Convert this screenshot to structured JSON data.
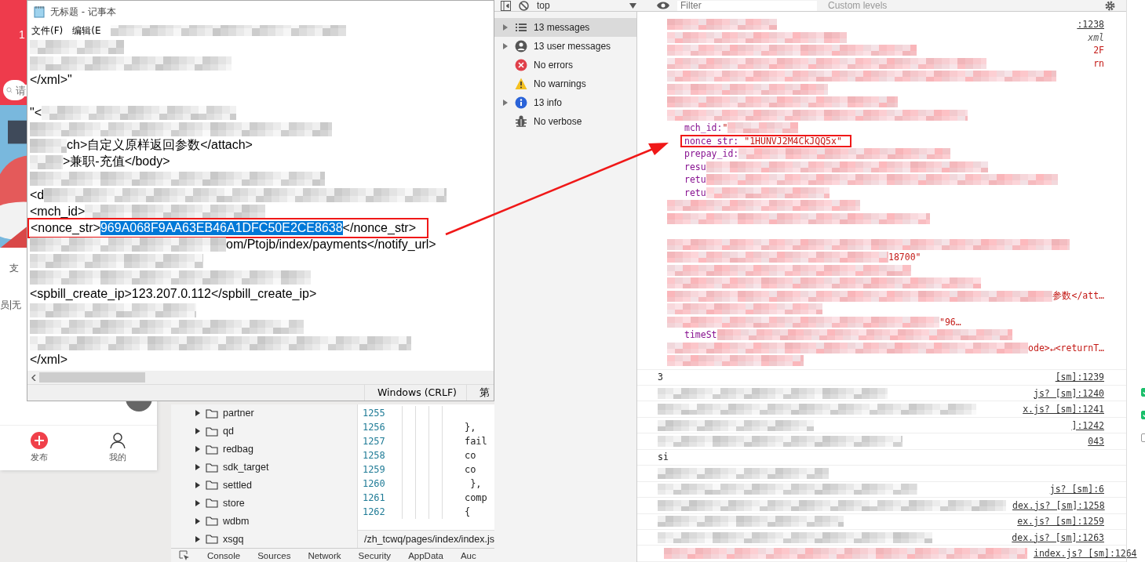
{
  "phone": {
    "status_text": "1",
    "search_placeholder": "请",
    "feed_texts": [
      "支",
      "员|无"
    ],
    "tabbar": [
      {
        "label": "发布",
        "kind": "publish"
      },
      {
        "label": "我的",
        "kind": "profile"
      }
    ]
  },
  "notepad": {
    "title": "无标题 - 记事本",
    "menu": [
      "文件(F)",
      "编辑(E"
    ],
    "lines": [
      {
        "kind": "redacted"
      },
      {
        "kind": "redacted"
      },
      {
        "kind": "text",
        "text": "</xml>\""
      },
      {
        "kind": "blank"
      },
      {
        "kind": "head",
        "text": "\"<"
      },
      {
        "kind": "redacted"
      },
      {
        "kind": "tail",
        "text": "ch>自定义原样返回参数</attach>"
      },
      {
        "kind": "tail",
        "text": ">兼职-充值</body>"
      },
      {
        "kind": "redacted"
      },
      {
        "kind": "head",
        "text": "<d"
      },
      {
        "kind": "head",
        "text": "<mch_id>"
      },
      {
        "kind": "selection",
        "before": "<nonce_str>",
        "selected_text": "969A068F9AA63EB46A1DFC50E2CE8638",
        "after": "</nonce_str>"
      },
      {
        "kind": "tail",
        "text": "om/Ptojb/index/payments</notify_url>"
      },
      {
        "kind": "redacted"
      },
      {
        "kind": "redacted"
      },
      {
        "kind": "text",
        "text": "<spbill_create_ip>123.207.0.112</spbill_create_ip>"
      },
      {
        "kind": "redacted"
      },
      {
        "kind": "redacted"
      },
      {
        "kind": "redacted"
      },
      {
        "kind": "text",
        "text": "</xml>"
      }
    ],
    "status": [
      "Windows (CRLF)",
      "第"
    ]
  },
  "sources": {
    "folders": [
      "partner",
      "qd",
      "redbag",
      "sdk_target",
      "settled",
      "store",
      "wdbm",
      "xsgq"
    ],
    "code_lines": [
      {
        "num": "1255"
      },
      {
        "num": "1256",
        "code": "},"
      },
      {
        "num": "1257",
        "code": "fail"
      },
      {
        "num": "1258",
        "code": "co"
      },
      {
        "num": "1259",
        "code": "co"
      },
      {
        "num": "1260",
        "code": " },"
      },
      {
        "num": "1261",
        "code": "comp"
      },
      {
        "num": "1262",
        "code": "{"
      }
    ],
    "file_path": "/zh_tcwq/pages/index/index.js"
  },
  "drawer_tabs": [
    "Console",
    "Sources",
    "Network",
    "Security",
    "AppData",
    "Auc"
  ],
  "console": {
    "context": "top",
    "filter_placeholder": "Filter",
    "levels": "Custom levels",
    "sidebar": [
      {
        "kind": "messages",
        "label": "13 messages",
        "expandable": true,
        "selected": true
      },
      {
        "kind": "user",
        "label": "13 user messages",
        "expandable": true,
        "selected": false
      },
      {
        "kind": "errors",
        "label": "No errors",
        "expandable": false,
        "selected": false
      },
      {
        "kind": "warnings",
        "label": "No warnings",
        "expandable": false,
        "selected": false
      },
      {
        "kind": "info",
        "label": "13 info",
        "expandable": true,
        "selected": false
      },
      {
        "kind": "verbose",
        "label": "No verbose",
        "expandable": false,
        "selected": false
      }
    ],
    "object_lines": [
      {
        "kind": "redacted",
        "right": {
          "kind": "link",
          "text": ":1238"
        }
      },
      {
        "kind": "redacted",
        "right": {
          "kind": "muted",
          "text": "xml"
        }
      },
      {
        "kind": "redacted",
        "right": {
          "kind": "string",
          "text": "2F"
        }
      },
      {
        "kind": "redacted",
        "right": {
          "kind": "string",
          "text": "rn"
        }
      },
      {
        "kind": "redacted"
      },
      {
        "kind": "redacted"
      },
      {
        "kind": "redacted"
      },
      {
        "kind": "redacted"
      },
      {
        "kind": "pair",
        "key": "mch_id:",
        "value": "\""
      },
      {
        "kind": "framed_pair",
        "key": "nonce_str:",
        "value": "\"1HUNVJ2M4CkJQQ5x\""
      },
      {
        "kind": "key",
        "key": "prepay_id:"
      },
      {
        "kind": "key",
        "key": "resu"
      },
      {
        "kind": "key",
        "key": "retu"
      },
      {
        "kind": "key",
        "key": "retu"
      },
      {
        "kind": "redacted"
      },
      {
        "kind": "redacted"
      },
      {
        "kind": "blank"
      },
      {
        "kind": "redacted"
      },
      {
        "kind": "tail",
        "value": "18700\""
      },
      {
        "kind": "redacted"
      },
      {
        "kind": "redacted"
      },
      {
        "kind": "tail",
        "value": "参数</att…"
      },
      {
        "kind": "redacted"
      },
      {
        "kind": "tail",
        "value": "\"96…"
      },
      {
        "kind": "key",
        "key": "timeSt"
      },
      {
        "kind": "tail",
        "value": "ode>↵<return",
        "right": {
          "kind": "string",
          "text": "T…"
        }
      },
      {
        "kind": "redacted"
      }
    ],
    "log_rows": [
      {
        "kind": "plain",
        "text": "3",
        "source": "[sm]:1239"
      },
      {
        "kind": "redacted",
        "source": "js? [sm]:1240"
      },
      {
        "kind": "redacted",
        "source": "x.js? [sm]:1241"
      },
      {
        "kind": "redacted",
        "source": "]:1242"
      },
      {
        "kind": "redacted",
        "source": "043"
      },
      {
        "kind": "plain",
        "text": "si"
      },
      {
        "kind": "redacted"
      },
      {
        "kind": "redacted",
        "source": "js? [sm]:6"
      },
      {
        "kind": "redacted",
        "source": "dex.js? [sm]:1258"
      },
      {
        "kind": "redacted",
        "source": "ex.js? [sm]:1259"
      },
      {
        "kind": "redacted",
        "source": "dex.js? [sm]:1263"
      },
      {
        "kind": "collapsed",
        "source": "index.js? [sm]:1264"
      }
    ]
  },
  "side_checks": [
    {
      "checked": true
    },
    {
      "checked": true
    },
    {
      "checked": false
    }
  ]
}
